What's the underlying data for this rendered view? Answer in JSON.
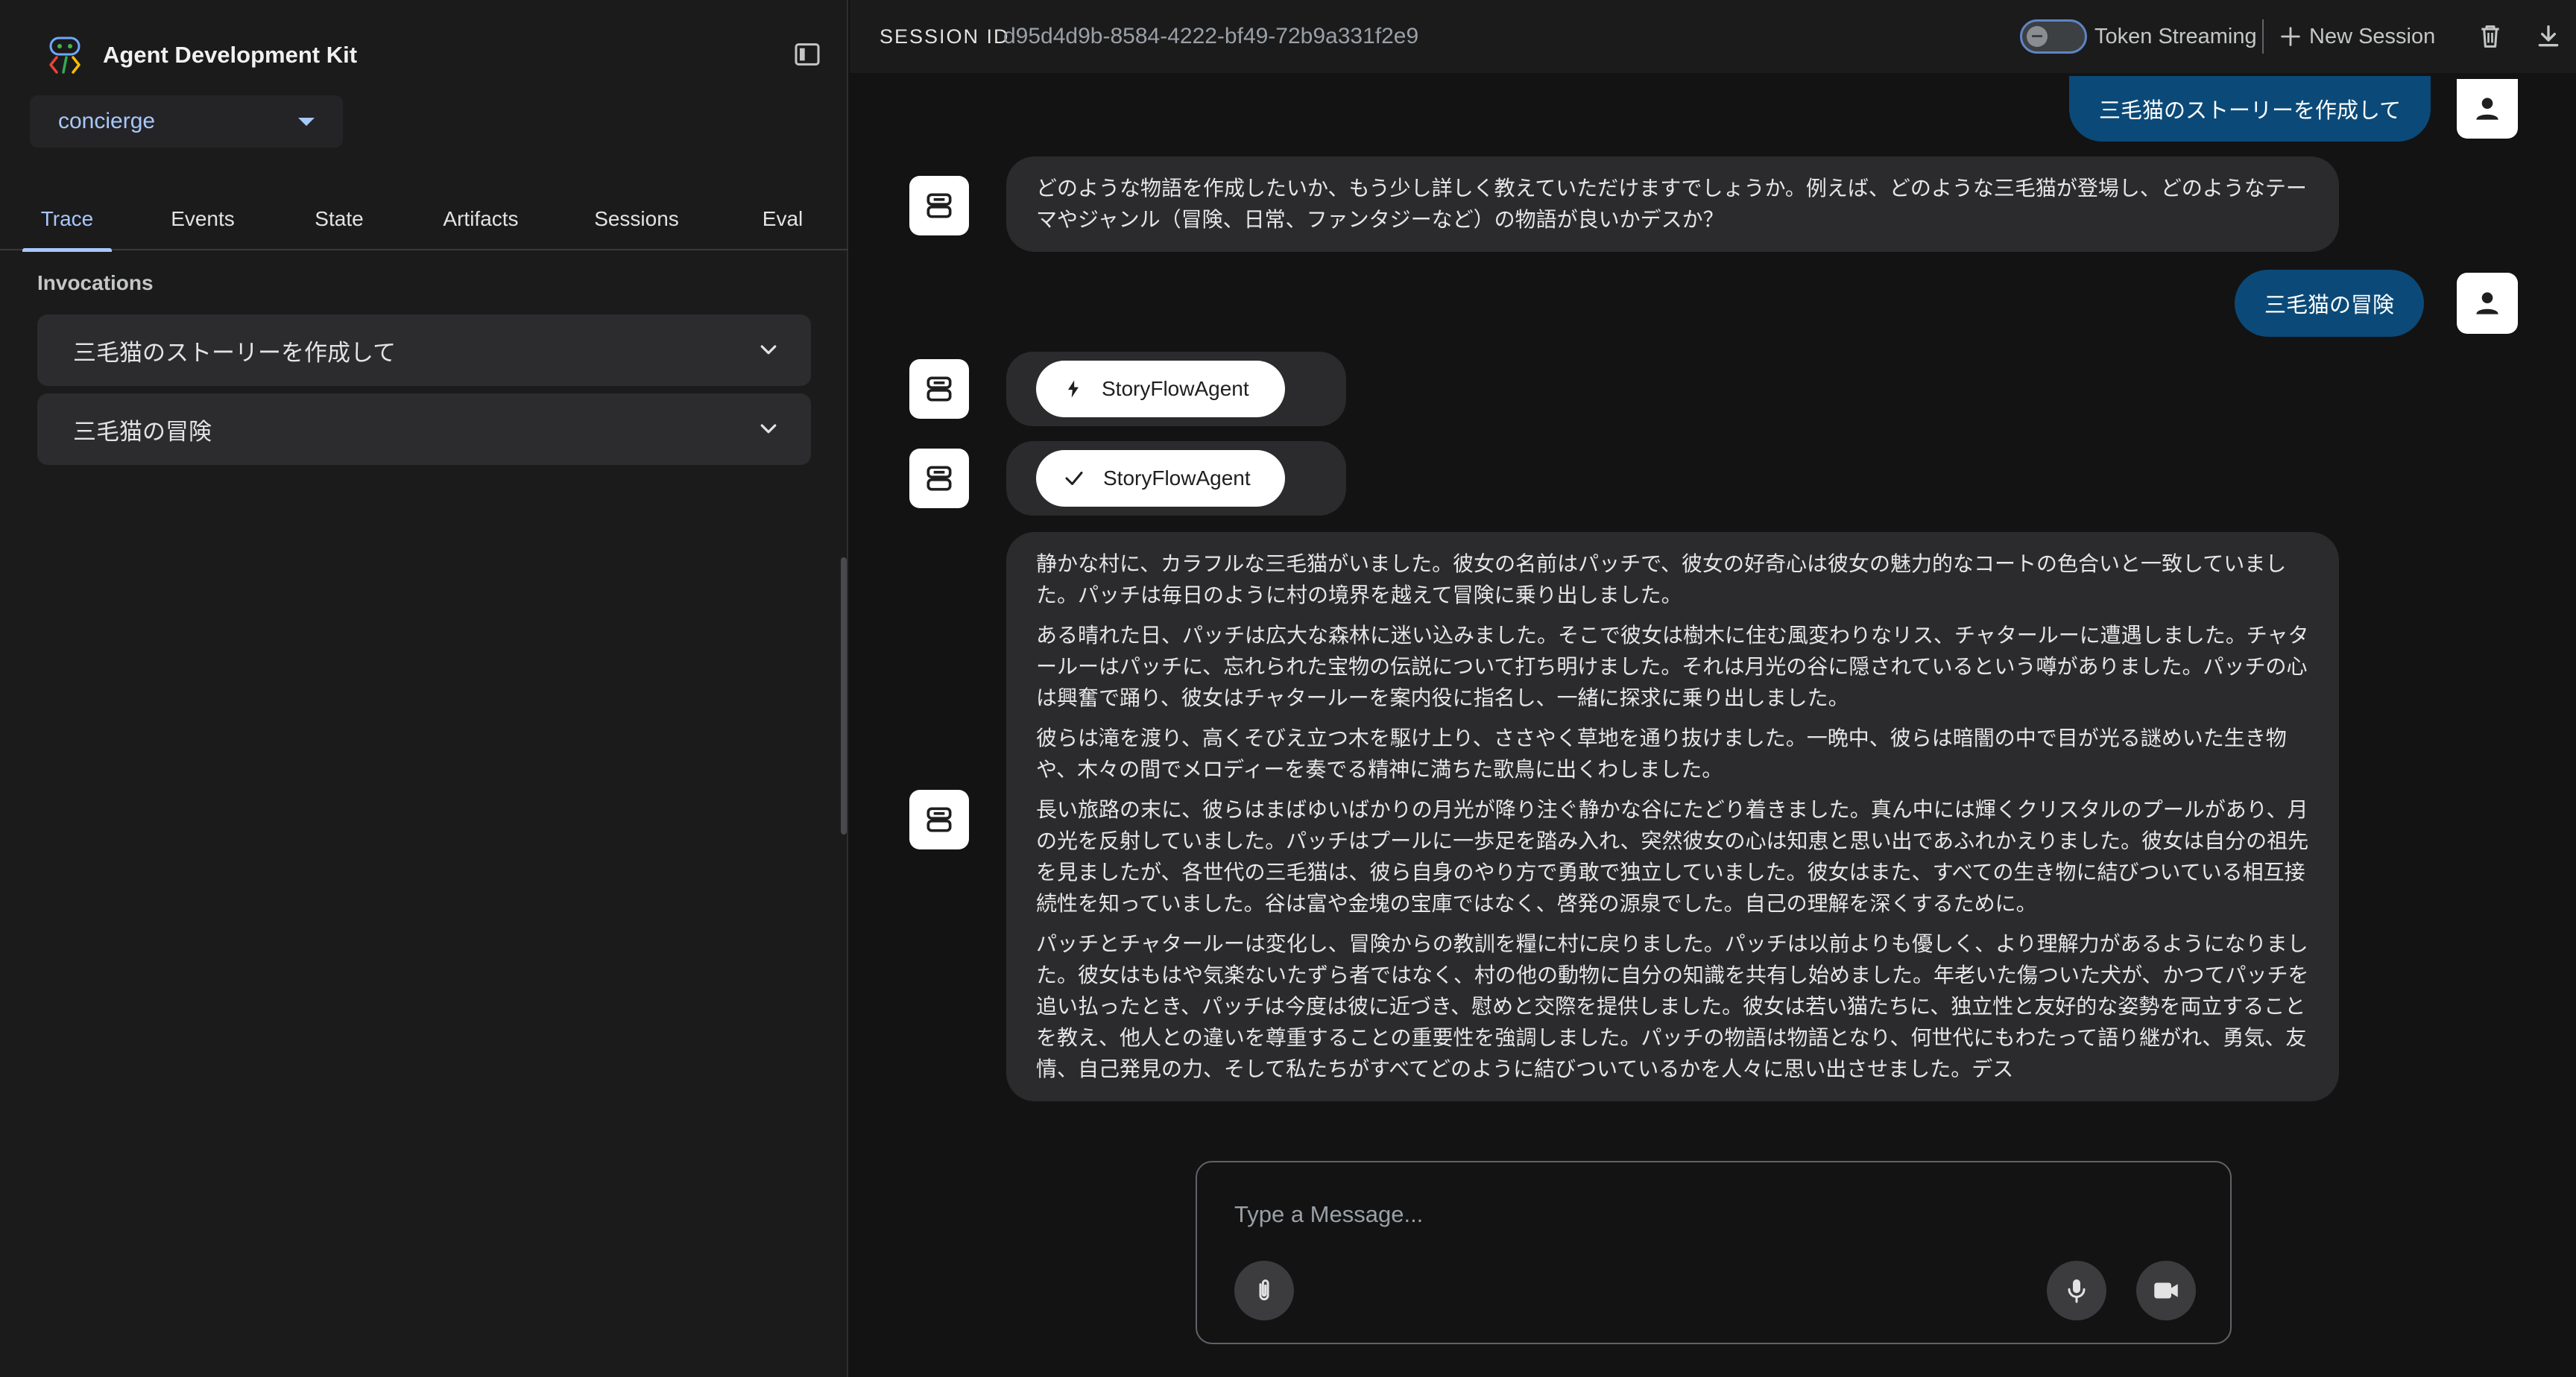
{
  "app": {
    "title": "Agent Development Kit"
  },
  "agent_select": {
    "value": "concierge"
  },
  "tabs": [
    {
      "label": "Trace",
      "active": true
    },
    {
      "label": "Events"
    },
    {
      "label": "State"
    },
    {
      "label": "Artifacts"
    },
    {
      "label": "Sessions"
    },
    {
      "label": "Eval"
    }
  ],
  "invocations": {
    "title": "Invocations",
    "items": [
      {
        "label": "三毛猫のストーリーを作成して"
      },
      {
        "label": "三毛猫の冒険"
      }
    ]
  },
  "topbar": {
    "session_label": "SESSION ID",
    "session_id": "d95d4d9b-8584-4222-bf49-72b9a331f2e9",
    "token_streaming_label": "Token Streaming",
    "token_streaming_on": false,
    "new_session_label": "New Session"
  },
  "chat": {
    "user_msg_1": "三毛猫のストーリーを作成して",
    "bot_msg_1": "どのような物語を作成したいか、もう少し詳しく教えていただけますでしょうか。例えば、どのような三毛猫が登場し、どのようなテーマやジャンル（冒険、日常、ファンタジーなど）の物語が良いかデスか？",
    "user_msg_2": "三毛猫の冒険",
    "function_call_label": "StoryFlowAgent",
    "function_response_label": "StoryFlowAgent",
    "story": [
      "静かな村に、カラフルな三毛猫がいました。彼女の名前はパッチで、彼女の好奇心は彼女の魅力的なコートの色合いと一致していました。パッチは毎日のように村の境界を越えて冒険に乗り出しました。",
      "ある晴れた日、パッチは広大な森林に迷い込みました。そこで彼女は樹木に住む風変わりなリス、チャタールーに遭遇しました。チャタールーはパッチに、忘れられた宝物の伝説について打ち明けました。それは月光の谷に隠されているという噂がありました。パッチの心は興奮で踊り、彼女はチャタールーを案内役に指名し、一緒に探求に乗り出しました。",
      "彼らは滝を渡り、高くそびえ立つ木を駆け上り、ささやく草地を通り抜けました。一晩中、彼らは暗闇の中で目が光る謎めいた生き物や、木々の間でメロディーを奏でる精神に満ちた歌鳥に出くわしました。",
      "長い旅路の末に、彼らはまばゆいばかりの月光が降り注ぐ静かな谷にたどり着きました。真ん中には輝くクリスタルのプールがあり、月の光を反射していました。パッチはプールに一歩足を踏み入れ、突然彼女の心は知恵と思い出であふれかえりました。彼女は自分の祖先を見ましたが、各世代の三毛猫は、彼ら自身のやり方で勇敢で独立していました。彼女はまた、すべての生き物に結びついている相互接続性を知っていました。谷は富や金塊の宝庫ではなく、啓発の源泉でした。自己の理解を深くするために。",
      "パッチとチャタールーは変化し、冒険からの教訓を糧に村に戻りました。パッチは以前よりも優しく、より理解力があるようになりました。彼女はもはや気楽ないたずら者ではなく、村の他の動物に自分の知識を共有し始めました。年老いた傷ついた犬が、かつてパッチを追い払ったとき、パッチは今度は彼に近づき、慰めと交際を提供しました。彼女は若い猫たちに、独立性と友好的な姿勢を両立することを教え、他人との違いを尊重することの重要性を強調しました。パッチの物語は物語となり、何世代にもわたって語り継がれ、勇気、友情、自己発見の力、そして私たちがすべてどのように結びついているかを人々に思い出させました。デス"
    ]
  },
  "composer": {
    "placeholder": "Type a Message..."
  },
  "colors": {
    "accent": "#a8c7fa",
    "user_bubble": "#0b4a78",
    "bot_bubble": "#2b2b2d"
  }
}
